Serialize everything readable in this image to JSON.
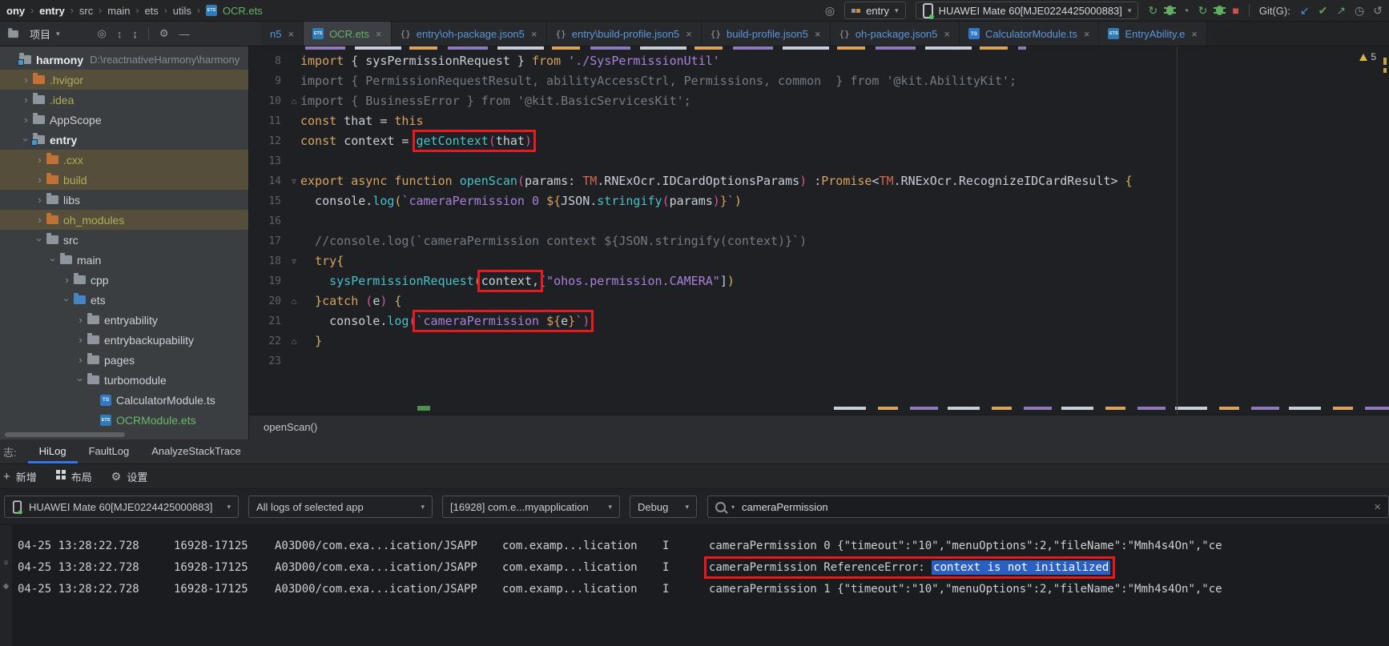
{
  "colors": {
    "accent_blue": "#3574f0",
    "annotation_red": "#e9191d",
    "selection_blue": "#2d5fc0",
    "modified_file_blue": "#5b97d8",
    "new_file_green": "#67b168",
    "warning_yellow": "#d8b44a",
    "run_green": "#5fae63",
    "stop_red": "#d64f4f",
    "excluded_row_bg": "#544e3b"
  },
  "topbar": {
    "breadcrumb": [
      {
        "t": "ony",
        "b": 1
      },
      {
        "t": "entry",
        "b": 1
      },
      {
        "t": "src"
      },
      {
        "t": "main"
      },
      {
        "t": "ets"
      },
      {
        "t": "utils"
      },
      {
        "t": "OCR.ets",
        "g": 1,
        "ico": "ets"
      }
    ],
    "run_config": "entry",
    "device": "HUAWEI Mate 60[MJE0224425000883]",
    "git_label": "Git(G):",
    "run_icons": [
      {
        "n": "rerun-icon",
        "type": "g",
        "g": "↻",
        "c": "#5fae63"
      },
      {
        "n": "debug-icon",
        "type": "bug"
      },
      {
        "n": "profiler-icon",
        "type": "g",
        "g": "◔",
        "c": "#8b9096"
      },
      {
        "n": "sync-icon",
        "type": "g",
        "g": "↻",
        "c": "#5fae63"
      },
      {
        "n": "attach-debugger-icon",
        "type": "bug"
      },
      {
        "n": "stop-icon",
        "type": "g",
        "g": "■",
        "c": "#d64f4f"
      }
    ],
    "git_icons": [
      {
        "n": "git-update-icon",
        "g": "↙",
        "c": "#4f8fe0"
      },
      {
        "n": "git-commit-icon",
        "g": "✔",
        "c": "#5ba35f"
      },
      {
        "n": "git-push-icon",
        "g": "↗",
        "c": "#5ba35f"
      },
      {
        "n": "git-history-icon",
        "g": "◷",
        "c": "#8b9096"
      },
      {
        "n": "git-rollback-icon",
        "g": "↺",
        "c": "#8b9096"
      }
    ]
  },
  "project_panel": {
    "title": "项目",
    "icons": [
      {
        "n": "select-opened-file-icon",
        "g": "◎"
      },
      {
        "n": "expand-all-icon",
        "g": "↕"
      },
      {
        "n": "collapse-all-icon",
        "g": "↨"
      },
      {
        "n": "divider"
      },
      {
        "n": "settings-icon",
        "g": "⚙"
      },
      {
        "n": "hide-panel-icon",
        "g": "—"
      }
    ],
    "tree": [
      {
        "label": "harmony",
        "depth": 0,
        "icon": "fmod",
        "bold": 1,
        "path": "D:\\reactnativeHarmony\\harmony"
      },
      {
        "label": ".hvigor",
        "depth": 1,
        "chev": "c",
        "icon": "fex",
        "olive": 1,
        "hl": 1
      },
      {
        "label": ".idea",
        "depth": 1,
        "chev": "c",
        "icon": "f",
        "olive": 1
      },
      {
        "label": "AppScope",
        "depth": 1,
        "chev": "c",
        "icon": "f"
      },
      {
        "label": "entry",
        "depth": 1,
        "chev": "o",
        "icon": "fmod",
        "bold": 1
      },
      {
        "label": ".cxx",
        "depth": 2,
        "chev": "c",
        "icon": "fex",
        "olive": 1,
        "hl": 1
      },
      {
        "label": "build",
        "depth": 2,
        "chev": "c",
        "icon": "fex",
        "olive": 1,
        "hl": 1
      },
      {
        "label": "libs",
        "depth": 2,
        "chev": "c",
        "icon": "f"
      },
      {
        "label": "oh_modules",
        "depth": 2,
        "chev": "c",
        "icon": "fex",
        "olive": 1,
        "hl": 1
      },
      {
        "label": "src",
        "depth": 2,
        "chev": "o",
        "icon": "f"
      },
      {
        "label": "main",
        "depth": 3,
        "chev": "o",
        "icon": "f"
      },
      {
        "label": "cpp",
        "depth": 4,
        "chev": "c",
        "icon": "f"
      },
      {
        "label": "ets",
        "depth": 4,
        "chev": "o",
        "icon": "fsrc"
      },
      {
        "label": "entryability",
        "depth": 5,
        "chev": "c",
        "icon": "f"
      },
      {
        "label": "entrybackupability",
        "depth": 5,
        "chev": "c",
        "icon": "f"
      },
      {
        "label": "pages",
        "depth": 5,
        "chev": "c",
        "icon": "f"
      },
      {
        "label": "turbomodule",
        "depth": 5,
        "chev": "o",
        "icon": "f"
      },
      {
        "label": "CalculatorModule.ts",
        "depth": 6,
        "icon": "ts"
      },
      {
        "label": "OCRModule.ets",
        "depth": 6,
        "icon": "ets",
        "green": 1
      }
    ]
  },
  "tabs": [
    {
      "label": "n5",
      "cls": "blue",
      "partial": 1
    },
    {
      "label": "OCR.ets",
      "icon": "ets",
      "cls": "green",
      "active": 1
    },
    {
      "label": "entry\\oh-package.json5",
      "icon": "json",
      "cls": "blue"
    },
    {
      "label": "entry\\build-profile.json5",
      "icon": "json",
      "cls": "blue"
    },
    {
      "label": "build-profile.json5",
      "icon": "json",
      "cls": "blue"
    },
    {
      "label": "oh-package.json5",
      "icon": "json",
      "cls": "blue"
    },
    {
      "label": "CalculatorModule.ts",
      "icon": "ts",
      "cls": "blue"
    },
    {
      "label": "EntryAbility.e",
      "icon": "ets",
      "cls": "blue"
    }
  ],
  "editor": {
    "context_bar": "openScan()",
    "warning_count": "5",
    "lines": [
      {
        "n": 8,
        "t": [
          [
            "k",
            "import "
          ],
          [
            "p",
            "{ sysPermissionRequest } "
          ],
          [
            "k",
            "from "
          ],
          [
            "s",
            "'./SysPermissionUtil'"
          ]
        ]
      },
      {
        "n": 9,
        "t": [
          [
            "g",
            "import { PermissionRequestResult, abilityAccessCtrl, Permissions, common  } from '@kit.AbilityKit';"
          ]
        ]
      },
      {
        "n": 10,
        "f": "⌂",
        "t": [
          [
            "g",
            "import { BusinessError } from '@kit.BasicServicesKit';"
          ]
        ]
      },
      {
        "n": 11,
        "t": [
          [
            "k",
            "const "
          ],
          [
            "p",
            "that = "
          ],
          [
            "k",
            "this"
          ]
        ]
      },
      {
        "n": 12,
        "t": [
          [
            "k",
            "const "
          ],
          [
            "p",
            "context = "
          ],
          [
            "f",
            "getContext",
            1
          ],
          [
            "pk",
            "(",
            1
          ],
          [
            "p",
            "that",
            1
          ],
          [
            "pk",
            ")",
            1
          ]
        ]
      },
      {
        "n": 13,
        "t": []
      },
      {
        "n": 14,
        "f": "▿",
        "t": [
          [
            "k",
            "export async function "
          ],
          [
            "f",
            "openScan"
          ],
          [
            "pk",
            "("
          ],
          [
            "p",
            "params: "
          ],
          [
            "r",
            "TM"
          ],
          [
            "p",
            ".RNExOcr.IDCardOptionsParams"
          ],
          [
            "pk",
            ") "
          ],
          [
            "p",
            ":"
          ],
          [
            "k",
            "Promise"
          ],
          [
            "p",
            "<"
          ],
          [
            "r",
            "TM"
          ],
          [
            "p",
            ".RNExOcr.RecognizeIDCardResult"
          ],
          [
            "p",
            "> "
          ],
          [
            "y",
            "{"
          ]
        ]
      },
      {
        "n": 15,
        "t": [
          [
            "p",
            "  console."
          ],
          [
            "f",
            "log"
          ],
          [
            "y",
            "("
          ],
          [
            "s",
            "`cameraPermission 0 "
          ],
          [
            "k",
            "${"
          ],
          [
            "p",
            "JSON."
          ],
          [
            "f",
            "stringify"
          ],
          [
            "pk",
            "("
          ],
          [
            "p",
            "params"
          ],
          [
            "pk",
            ")"
          ],
          [
            "k",
            "}"
          ],
          [
            "s",
            "`"
          ],
          [
            "y",
            ")"
          ]
        ]
      },
      {
        "n": 16,
        "t": []
      },
      {
        "n": 17,
        "t": [
          [
            "g",
            "  //console.log(`cameraPermission context ${JSON.stringify(context)}`)"
          ]
        ]
      },
      {
        "n": 18,
        "f": "▿",
        "t": [
          [
            "p",
            "  "
          ],
          [
            "k",
            "try"
          ],
          [
            "y",
            "{"
          ]
        ]
      },
      {
        "n": 19,
        "t": [
          [
            "p",
            "    "
          ],
          [
            "f",
            "sysPermissionRequest"
          ],
          [
            "y",
            "("
          ],
          [
            "p",
            "context",
            1
          ],
          [
            "p",
            ",",
            1
          ],
          [
            "p",
            "["
          ],
          [
            "s",
            "\"ohos.permission.CAMERA\""
          ],
          [
            "p",
            "]"
          ],
          [
            "y",
            ")"
          ]
        ]
      },
      {
        "n": 20,
        "f": "⌂",
        "t": [
          [
            "p",
            "  "
          ],
          [
            "y",
            "}"
          ],
          [
            "k",
            "catch "
          ],
          [
            "pk",
            "("
          ],
          [
            "p",
            "e"
          ],
          [
            "pk",
            ") "
          ],
          [
            "y",
            "{"
          ]
        ]
      },
      {
        "n": 21,
        "t": [
          [
            "p",
            "    console."
          ],
          [
            "f",
            "log"
          ],
          [
            "pk",
            "("
          ],
          [
            "s",
            "`cameraPermission ",
            1
          ],
          [
            "k",
            "${",
            1
          ],
          [
            "p",
            "e",
            1
          ],
          [
            "k",
            "}",
            1
          ],
          [
            "s",
            "`",
            1
          ],
          [
            "pk",
            ")",
            1
          ]
        ]
      },
      {
        "n": 22,
        "f": "⌂",
        "t": [
          [
            "p",
            "  "
          ],
          [
            "y",
            "}"
          ]
        ]
      },
      {
        "n": 23,
        "t": []
      }
    ]
  },
  "logpanel": {
    "title_partial": "志:",
    "tabs": [
      "HiLog",
      "FaultLog",
      "AnalyzeStackTrace"
    ],
    "active_tab": "HiLog",
    "toolbar": [
      {
        "icon": "plus",
        "label": "新增"
      },
      {
        "icon": "grid",
        "label": "布局"
      },
      {
        "icon": "gear",
        "label": "设置"
      }
    ],
    "filters": {
      "device": "HUAWEI Mate 60[MJE0224425000883]",
      "scope": "All logs of selected app",
      "process": "[16928] com.e...myapplication",
      "level": "Debug",
      "search": "cameraPermission"
    },
    "stripe_icons": [
      {
        "n": "stripe-icon-1",
        "g": "≡"
      },
      {
        "n": "stripe-icon-2",
        "g": "◆"
      }
    ],
    "rows": [
      {
        "time": "04-25 13:28:22.728",
        "pid": "16928-17125",
        "tag": "A03D00/com.exa...ication/JSAPP",
        "pkg": "com.examp...lication",
        "level": "I",
        "msg": "cameraPermission 0 {\"timeout\":\"10\",\"menuOptions\":2,\"fileName\":\"Mmh4s4On\",\"ce"
      },
      {
        "time": "04-25 13:28:22.728",
        "pid": "16928-17125",
        "tag": "A03D00/com.exa...ication/JSAPP",
        "pkg": "com.examp...lication",
        "level": "I",
        "msg_pre": "cameraPermission ReferenceError: ",
        "msg_sel": "context is not initialized",
        "boxed": 1
      },
      {
        "time": "04-25 13:28:22.728",
        "pid": "16928-17125",
        "tag": "A03D00/com.exa...ication/JSAPP",
        "pkg": "com.examp...lication",
        "level": "I",
        "msg": "cameraPermission 1 {\"timeout\":\"10\",\"menuOptions\":2,\"fileName\":\"Mmh4s4On\",\"ce"
      }
    ]
  }
}
